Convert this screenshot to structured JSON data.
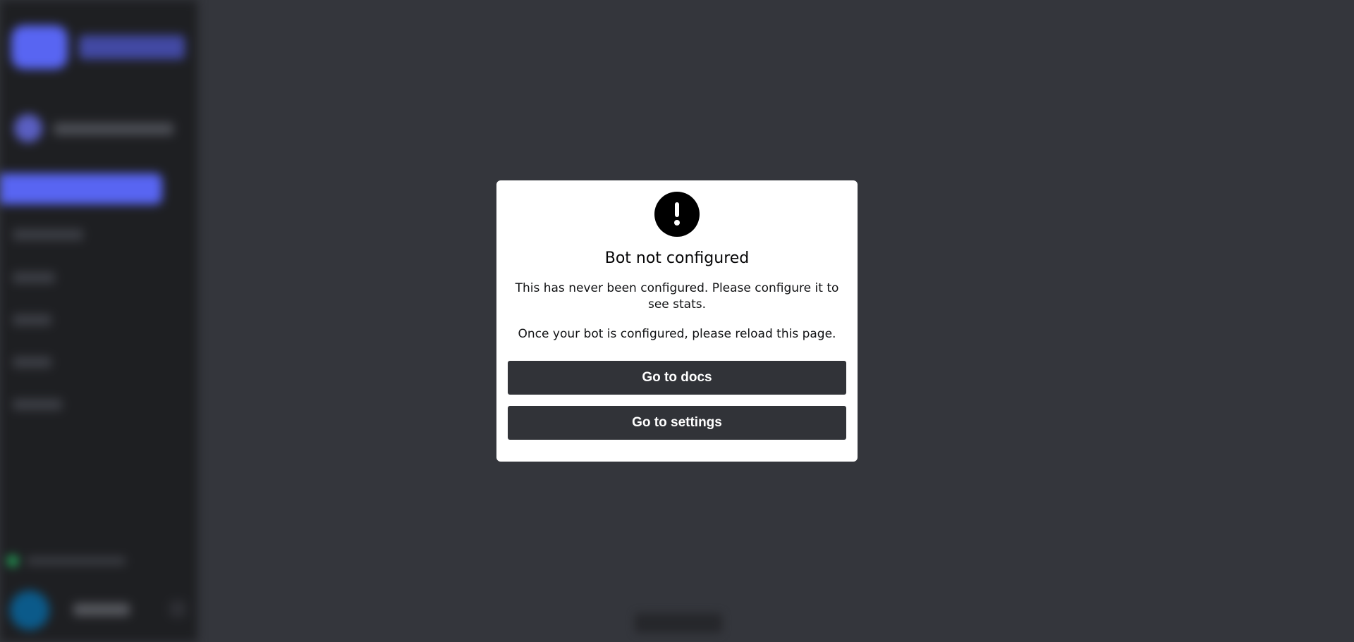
{
  "modal": {
    "icon": "exclamation-circle-icon",
    "title": "Bot not configured",
    "body_line_1": "This has never been configured. Please configure it to see stats.",
    "body_line_2": "Once your bot is configured, please reload this page.",
    "docs_button": "Go to docs",
    "settings_button": "Go to settings"
  },
  "colors": {
    "background": "#313338",
    "sidebar": "#1e1f22",
    "accent": "#5865f2",
    "button": "#313338",
    "modal": "#ffffff",
    "online": "#23a559"
  }
}
